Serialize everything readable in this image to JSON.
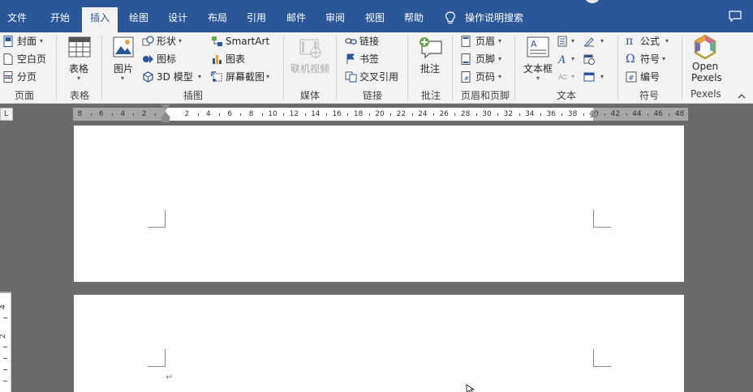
{
  "tabs": [
    {
      "label": "文件"
    },
    {
      "label": "开始"
    },
    {
      "label": "插入"
    },
    {
      "label": "绘图"
    },
    {
      "label": "设计"
    },
    {
      "label": "布局"
    },
    {
      "label": "引用"
    },
    {
      "label": "邮件"
    },
    {
      "label": "审阅"
    },
    {
      "label": "视图"
    },
    {
      "label": "帮助"
    }
  ],
  "active_tab": "插入",
  "search": {
    "label": "操作说明搜索",
    "icon": "lightbulb-icon"
  },
  "ribbon": {
    "pages": {
      "cover": "封面",
      "blank": "空白页",
      "break": "分页",
      "label": "页面"
    },
    "tables": {
      "table": "表格",
      "label": "表格"
    },
    "illustrations": {
      "pictures": "图片",
      "shapes": "形状",
      "icons": "图标",
      "model3d": "3D 模型",
      "smartart": "SmartArt",
      "chart": "图表",
      "screenshot": "屏幕截图",
      "label": "插图"
    },
    "media": {
      "online_video": "联机视频",
      "label": "媒体"
    },
    "links": {
      "link": "链接",
      "bookmark": "书签",
      "crossref": "交叉引用",
      "label": "链接"
    },
    "comments": {
      "comment": "批注",
      "label": "批注"
    },
    "header_footer": {
      "header": "页眉",
      "footer": "页脚",
      "page_number": "页码",
      "label": "页眉和页脚"
    },
    "text": {
      "textbox": "文本框",
      "label": "文本"
    },
    "symbols": {
      "equation": "公式",
      "symbol": "符号",
      "number": "编号",
      "label": "符号"
    },
    "pexels": {
      "open": "Open",
      "pexels": "Pexels",
      "label": "Pexels"
    }
  },
  "ruler": {
    "corner": "L",
    "ticks": [
      "8",
      "6",
      "4",
      "2",
      "2",
      "4",
      "6",
      "8",
      "10",
      "12",
      "14",
      "16",
      "18",
      "20",
      "22",
      "24",
      "26",
      "28",
      "30",
      "32",
      "34",
      "36",
      "38",
      "40",
      "42",
      "44",
      "46",
      "48"
    ]
  },
  "vruler": {
    "ticks": [
      "4",
      "2"
    ]
  },
  "colors": {
    "title_bar": "#2b579a",
    "ribbon": "#f3f3f3",
    "workspace": "#6b6b6b"
  }
}
